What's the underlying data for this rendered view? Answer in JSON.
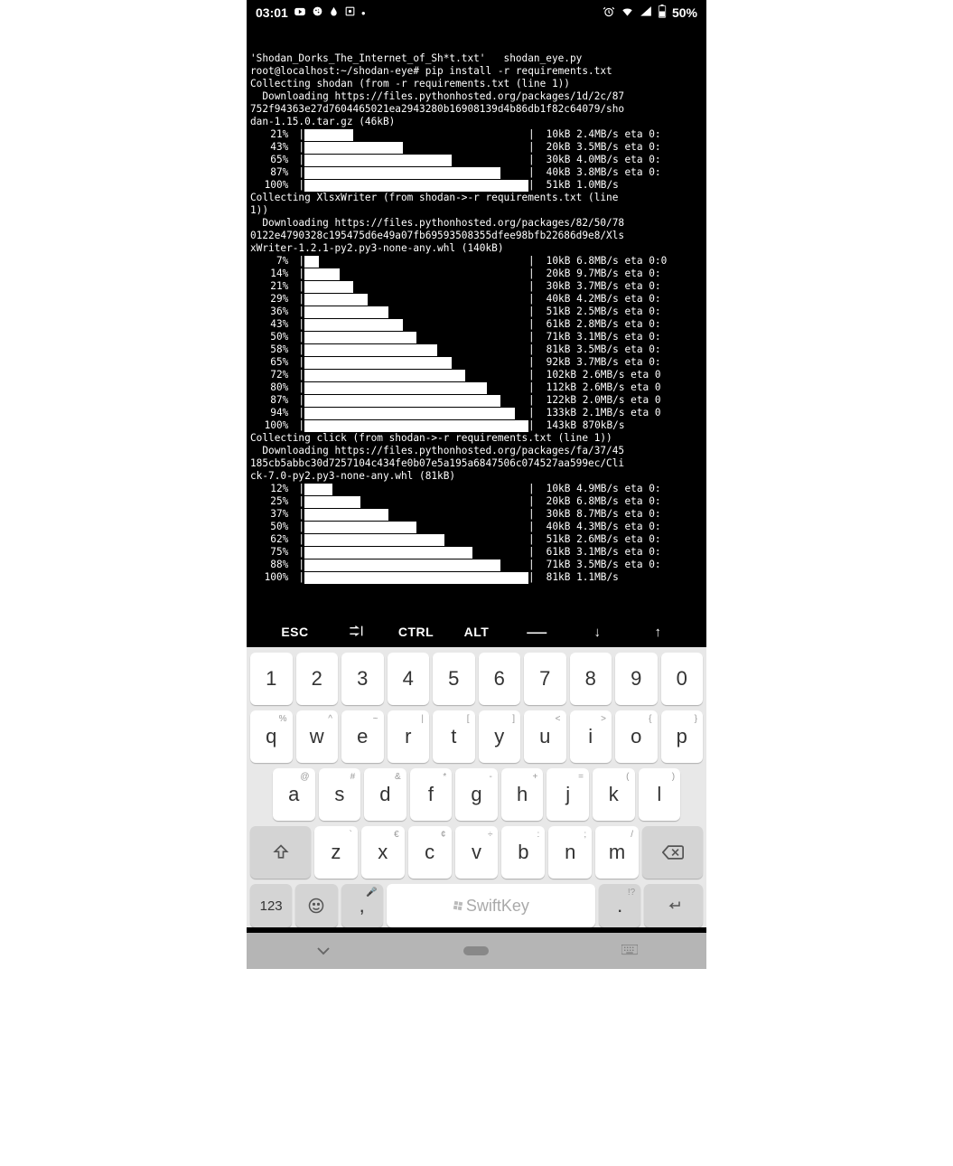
{
  "status": {
    "time": "03:01",
    "battery_pct": "50%",
    "icons_left": [
      "youtube",
      "cookie",
      "drop",
      "screen-rec",
      "dot"
    ],
    "icons_right": [
      "alarm",
      "wifi",
      "signal",
      "battery"
    ]
  },
  "terminal": {
    "header_lines": [
      "'Shodan_Dorks_The_Internet_of_Sh*t.txt'   shodan_eye.py",
      "root@localhost:~/shodan-eye# pip install -r requirements.txt",
      "Collecting shodan (from -r requirements.txt (line 1))",
      "  Downloading https://files.pythonhosted.org/packages/1d/2c/87",
      "752f94363e27d7604465021ea2943280b16908139d4b86db1f82c64079/sho",
      "dan-1.15.0.tar.gz (46kB)"
    ],
    "block1": [
      {
        "pct": "21%",
        "fill": 7,
        "stat": "10kB 2.4MB/s eta 0:"
      },
      {
        "pct": "43%",
        "fill": 14,
        "stat": "20kB 3.5MB/s eta 0:"
      },
      {
        "pct": "65%",
        "fill": 21,
        "stat": "30kB 4.0MB/s eta 0:"
      },
      {
        "pct": "87%",
        "fill": 28,
        "stat": "40kB 3.8MB/s eta 0:"
      },
      {
        "pct": "100%",
        "fill": 32,
        "stat": "51kB 1.0MB/s"
      }
    ],
    "mid1_lines": [
      "Collecting XlsxWriter (from shodan->-r requirements.txt (line ",
      "1))",
      "  Downloading https://files.pythonhosted.org/packages/82/50/78",
      "0122e4790328c195475d6e49a07fb69593508355dfee98bfb22686d9e8/Xls",
      "xWriter-1.2.1-py2.py3-none-any.whl (140kB)"
    ],
    "block2": [
      {
        "pct": "7%",
        "fill": 2,
        "stat": "10kB 6.8MB/s eta 0:0"
      },
      {
        "pct": "14%",
        "fill": 5,
        "stat": "20kB 9.7MB/s eta 0:"
      },
      {
        "pct": "21%",
        "fill": 7,
        "stat": "30kB 3.7MB/s eta 0:"
      },
      {
        "pct": "29%",
        "fill": 9,
        "stat": "40kB 4.2MB/s eta 0:"
      },
      {
        "pct": "36%",
        "fill": 12,
        "stat": "51kB 2.5MB/s eta 0:"
      },
      {
        "pct": "43%",
        "fill": 14,
        "stat": "61kB 2.8MB/s eta 0:"
      },
      {
        "pct": "50%",
        "fill": 16,
        "stat": "71kB 3.1MB/s eta 0:"
      },
      {
        "pct": "58%",
        "fill": 19,
        "stat": "81kB 3.5MB/s eta 0:"
      },
      {
        "pct": "65%",
        "fill": 21,
        "stat": "92kB 3.7MB/s eta 0:"
      },
      {
        "pct": "72%",
        "fill": 23,
        "stat": "102kB 2.6MB/s eta 0"
      },
      {
        "pct": "80%",
        "fill": 26,
        "stat": "112kB 2.6MB/s eta 0"
      },
      {
        "pct": "87%",
        "fill": 28,
        "stat": "122kB 2.0MB/s eta 0"
      },
      {
        "pct": "94%",
        "fill": 30,
        "stat": "133kB 2.1MB/s eta 0"
      },
      {
        "pct": "100%",
        "fill": 32,
        "stat": "143kB 870kB/s"
      }
    ],
    "mid2_lines": [
      "Collecting click (from shodan->-r requirements.txt (line 1))",
      "  Downloading https://files.pythonhosted.org/packages/fa/37/45",
      "185cb5abbc30d7257104c434fe0b07e5a195a6847506c074527aa599ec/Cli",
      "ck-7.0-py2.py3-none-any.whl (81kB)"
    ],
    "block3": [
      {
        "pct": "12%",
        "fill": 4,
        "stat": "10kB 4.9MB/s eta 0:"
      },
      {
        "pct": "25%",
        "fill": 8,
        "stat": "20kB 6.8MB/s eta 0:"
      },
      {
        "pct": "37%",
        "fill": 12,
        "stat": "30kB 8.7MB/s eta 0:"
      },
      {
        "pct": "50%",
        "fill": 16,
        "stat": "40kB 4.3MB/s eta 0:"
      },
      {
        "pct": "62%",
        "fill": 20,
        "stat": "51kB 2.6MB/s eta 0:"
      },
      {
        "pct": "75%",
        "fill": 24,
        "stat": "61kB 3.1MB/s eta 0:"
      },
      {
        "pct": "88%",
        "fill": 28,
        "stat": "71kB 3.5MB/s eta 0:"
      },
      {
        "pct": "100%",
        "fill": 32,
        "stat": "81kB 1.1MB/s"
      }
    ]
  },
  "extra_keys": {
    "esc": "ESC",
    "ctrl": "CTRL",
    "alt": "ALT",
    "dash": "—",
    "down": "↓",
    "up": "↑"
  },
  "keyboard": {
    "row1": [
      "1",
      "2",
      "3",
      "4",
      "5",
      "6",
      "7",
      "8",
      "9",
      "0"
    ],
    "row2": [
      {
        "k": "q",
        "s": "%"
      },
      {
        "k": "w",
        "s": "^"
      },
      {
        "k": "e",
        "s": "~"
      },
      {
        "k": "r",
        "s": "|"
      },
      {
        "k": "t",
        "s": "["
      },
      {
        "k": "y",
        "s": "]"
      },
      {
        "k": "u",
        "s": "<"
      },
      {
        "k": "i",
        "s": ">"
      },
      {
        "k": "o",
        "s": "{"
      },
      {
        "k": "p",
        "s": "}"
      }
    ],
    "row3": [
      {
        "k": "a",
        "s": "@"
      },
      {
        "k": "s",
        "s": "#"
      },
      {
        "k": "d",
        "s": "&"
      },
      {
        "k": "f",
        "s": "*"
      },
      {
        "k": "g",
        "s": "-"
      },
      {
        "k": "h",
        "s": "+"
      },
      {
        "k": "j",
        "s": "="
      },
      {
        "k": "k",
        "s": "("
      },
      {
        "k": "l",
        "s": ")"
      }
    ],
    "row4": [
      {
        "k": "z",
        "s": "`"
      },
      {
        "k": "x",
        "s": "€"
      },
      {
        "k": "c",
        "s": "¢"
      },
      {
        "k": "v",
        "s": "÷"
      },
      {
        "k": "b",
        "s": ":"
      },
      {
        "k": "n",
        "s": ";"
      },
      {
        "k": "m",
        "s": "/"
      }
    ],
    "bottom": {
      "num": "123",
      "comma": ",",
      "space": "SwiftKey",
      "period": ".",
      "comma_sup": "🎤",
      "period_sup": "!?"
    }
  }
}
